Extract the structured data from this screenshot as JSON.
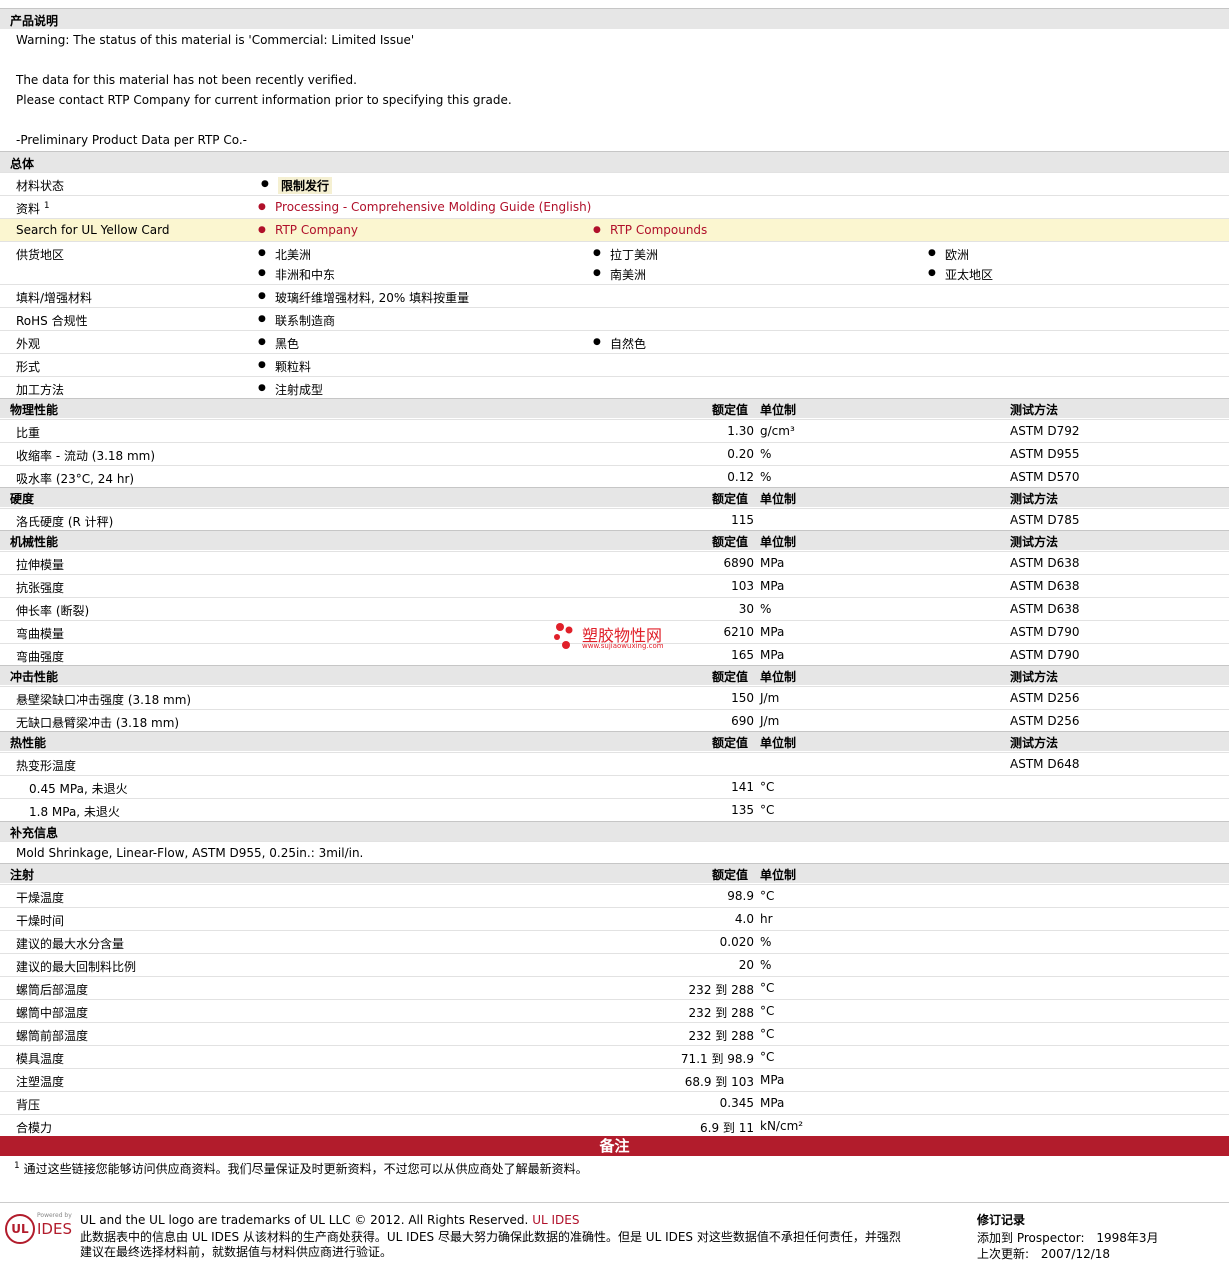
{
  "sections": {
    "desc": "产品说明",
    "general": "总体",
    "physical": "物理性能",
    "hardness": "硬度",
    "mechanical": "机械性能",
    "impact": "冲击性能",
    "thermal": "热性能",
    "supplement": "补充信息",
    "injection": "注射"
  },
  "col": {
    "nominal": "额定值",
    "unit": "单位制",
    "test": "测试方法"
  },
  "desc_lines": [
    "Warning: The status of this material is 'Commercial: Limited Issue'",
    "The data for this material has not been recently verified.",
    "Please contact RTP Company for current information prior to specifying this grade.",
    "-Preliminary Product Data per RTP Co.-"
  ],
  "general": {
    "status_label": "材料状态",
    "status_value": "限制发行",
    "docs_label": "资料",
    "docs_sup": "1",
    "docs_link": "Processing - Comprehensive Molding Guide (English)",
    "ul_label": "Search for UL Yellow Card",
    "ul_link1": "RTP Company",
    "ul_link2": "RTP Compounds",
    "region_label": "供货地区",
    "regions": [
      "北美洲",
      "拉丁美洲",
      "欧洲",
      "非洲和中东",
      "南美洲",
      "亚太地区"
    ],
    "filler_label": "填料/增强材料",
    "filler_value": "玻璃纤维增强材料, 20% 填料按重量",
    "rohs_label": "RoHS 合规性",
    "rohs_value": "联系制造商",
    "appearance_label": "外观",
    "appearance": [
      "黑色",
      "自然色"
    ],
    "form_label": "形式",
    "form_value": "颗粒料",
    "process_label": "加工方法",
    "process_value": "注射成型"
  },
  "physical": [
    {
      "label": "比重",
      "value": "1.30",
      "unit": "g/cm³",
      "test": "ASTM D792"
    },
    {
      "label": "收缩率  - 流动  (3.18 mm)",
      "value": "0.20",
      "unit": "%",
      "test": "ASTM D955"
    },
    {
      "label": "吸水率  (23°C, 24 hr)",
      "value": "0.12",
      "unit": "%",
      "test": "ASTM D570"
    }
  ],
  "hardness": [
    {
      "label": "洛氏硬度  (R 计秤)",
      "value": "115",
      "unit": "",
      "test": "ASTM D785"
    }
  ],
  "mechanical": [
    {
      "label": "拉伸模量",
      "value": "6890",
      "unit": "MPa",
      "test": "ASTM D638"
    },
    {
      "label": "抗张强度",
      "value": "103",
      "unit": "MPa",
      "test": "ASTM D638"
    },
    {
      "label": "伸长率  (断裂)",
      "value": "30",
      "unit": "%",
      "test": "ASTM D638"
    },
    {
      "label": "弯曲模量",
      "value": "6210",
      "unit": "MPa",
      "test": "ASTM D790"
    },
    {
      "label": "弯曲强度",
      "value": "165",
      "unit": "MPa",
      "test": "ASTM D790"
    }
  ],
  "impact": [
    {
      "label": "悬壁梁缺口冲击强度  (3.18 mm)",
      "value": "150",
      "unit": "J/m",
      "test": "ASTM D256"
    },
    {
      "label": "无缺口悬臂梁冲击  (3.18 mm)",
      "value": "690",
      "unit": "J/m",
      "test": "ASTM D256"
    }
  ],
  "thermal": {
    "label": "热变形温度",
    "test": "ASTM D648",
    "rows": [
      {
        "label": "0.45 MPa, 未退火",
        "value": "141",
        "unit": "°C"
      },
      {
        "label": "1.8 MPa, 未退火",
        "value": "135",
        "unit": "°C"
      }
    ]
  },
  "supplement_text": "Mold Shrinkage, Linear-Flow, ASTM D955, 0.25in.: 3mil/in.",
  "injection": [
    {
      "label": "干燥温度",
      "value": "98.9",
      "unit": "°C"
    },
    {
      "label": "干燥时间",
      "value": "4.0",
      "unit": "hr"
    },
    {
      "label": "建议的最大水分含量",
      "value": "0.020",
      "unit": "%"
    },
    {
      "label": "建议的最大回制料比例",
      "value": "20",
      "unit": "%"
    },
    {
      "label": "螺筒后部温度",
      "value": "232 到   288",
      "unit": "°C"
    },
    {
      "label": "螺筒中部温度",
      "value": "232 到   288",
      "unit": "°C"
    },
    {
      "label": "螺筒前部温度",
      "value": "232 到   288",
      "unit": "°C"
    },
    {
      "label": "模具温度",
      "value": "71.1 到  98.9",
      "unit": "°C"
    },
    {
      "label": "注塑温度",
      "value": "68.9 到   103",
      "unit": "MPa"
    },
    {
      "label": "背压",
      "value": "0.345",
      "unit": "MPa"
    },
    {
      "label": "合模力",
      "value": "6.9 到   11",
      "unit": "kN/cm²"
    }
  ],
  "notes_title": "备注",
  "footnote_num": "1",
  "footnote": "通过这些链接您能够访问供应商资料。我们尽量保证及时更新资料，不过您可以从供应商处了解最新资料。",
  "watermark": {
    "name": "塑胶物性网",
    "url": "www.sujiaowuxing.com"
  },
  "footer": {
    "logo_text": "UL",
    "logo_small": "Powered by",
    "logo_brand": "IDES",
    "line1": "UL and the UL logo are trademarks of UL LLC © 2012. All Rights Reserved.",
    "line1_link": "UL IDES",
    "line2": "此数据表中的信息由  UL IDES 从该材料的生产商处获得。UL IDES 尽最大努力确保此数据的准确性。但是  UL IDES 对这些数据值不承担任何责任，并强烈",
    "line3": "建议在最终选择材料前，就数据值与材料供应商进行验证。",
    "rev_title": "修订记录",
    "rev_added_label": "添加到  Prospector:",
    "rev_added": "1998年3月",
    "rev_updated_label": "上次更新:",
    "rev_updated": "2007/12/18"
  }
}
